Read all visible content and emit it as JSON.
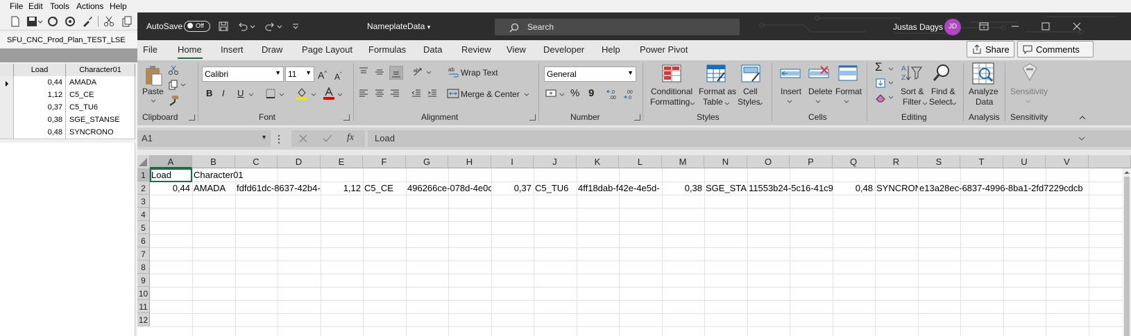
{
  "host": {
    "menu": [
      "File",
      "Edit",
      "Tools",
      "Actions",
      "Help"
    ],
    "title": "SFU_CNC_Prod_Plan_TEST_LSE",
    "grid": {
      "headers": [
        "Load",
        "Character01"
      ],
      "rows": [
        {
          "load": "0,44",
          "character": "AMADA"
        },
        {
          "load": "1,12",
          "character": "C5_CE"
        },
        {
          "load": "0,37",
          "character": "C5_TU6"
        },
        {
          "load": "0,38",
          "character": "SGE_STANSE"
        },
        {
          "load": "0,48",
          "character": "SYNCRONO"
        }
      ]
    }
  },
  "excel": {
    "autosave_label": "AutoSave",
    "autosave_state": "Off",
    "doc_name": "NameplateData",
    "search_placeholder": "Search",
    "user_name": "Justas Dagys",
    "user_initials": "JD",
    "accent_color": "#1e6c40",
    "avatar_color": "#b146c2",
    "tabs": [
      "File",
      "Home",
      "Insert",
      "Draw",
      "Page Layout",
      "Formulas",
      "Data",
      "Review",
      "View",
      "Developer",
      "Help",
      "Power Pivot"
    ],
    "active_tab": "Home",
    "share_label": "Share",
    "comments_label": "Comments",
    "ribbon": {
      "clipboard": {
        "paste": "Paste",
        "label": "Clipboard"
      },
      "font": {
        "name": "Calibri",
        "size": "11",
        "label": "Font",
        "bold": "B",
        "italic": "I",
        "underline": "U"
      },
      "alignment": {
        "wrap": "Wrap Text",
        "merge": "Merge & Center",
        "label": "Alignment"
      },
      "number": {
        "format": "General",
        "percent": "%",
        "comma": "9",
        "label": "Number"
      },
      "styles": {
        "conditional_1": "Conditional",
        "conditional_2": "Formatting",
        "table_1": "Format as",
        "table_2": "Table",
        "cell_1": "Cell",
        "cell_2": "Styles",
        "label": "Styles"
      },
      "cells": {
        "insert": "Insert",
        "delete": "Delete",
        "format": "Format",
        "label": "Cells"
      },
      "editing": {
        "sort_1": "Sort &",
        "sort_2": "Filter",
        "find_1": "Find &",
        "find_2": "Select",
        "label": "Editing",
        "sigma": "Σ"
      },
      "analysis": {
        "analyze_1": "Analyze",
        "analyze_2": "Data",
        "label": "Analysis"
      },
      "sensitivity": {
        "button": "Sensitivity",
        "label": "Sensitivity"
      }
    },
    "name_box": "A1",
    "formula": "Load",
    "fx": "fx",
    "columns": [
      "A",
      "B",
      "C",
      "D",
      "E",
      "F",
      "G",
      "H",
      "I",
      "J",
      "K",
      "L",
      "M",
      "N",
      "O",
      "P",
      "Q",
      "R",
      "S",
      "T",
      "U",
      "V"
    ],
    "rows": [
      "1",
      "2",
      "3",
      "4",
      "5",
      "6",
      "7",
      "8",
      "9",
      "10",
      "11",
      "12"
    ],
    "cells": {
      "A1": "Load",
      "B1": "Character01",
      "A2": "0,44",
      "B2": "AMADA",
      "C2": "fdfd61dc-8637-42b4-",
      "E2": "1,12",
      "F2": "C5_CE",
      "G2": "496266ce-078d-4e0c-",
      "I2": "0,37",
      "J2": "C5_TU6",
      "K2": "4ff18dab-f42e-4e5d-",
      "M2": "0,38",
      "N2": "SGE_STAN",
      "O2": "11553b24-5c16-41c9-",
      "Q2": "0,48",
      "R2": "SYNCRON",
      "S2": "e13a28ec-6837-4996-8ba1-2fd7229cdcb"
    }
  }
}
